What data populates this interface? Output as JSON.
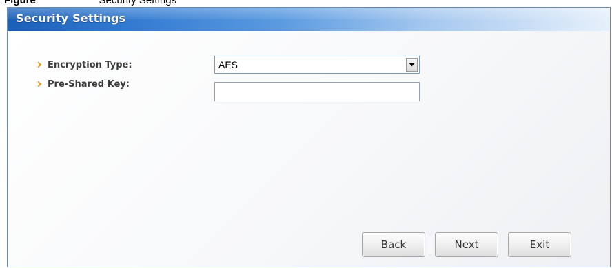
{
  "caption": {
    "prefix": "Figure",
    "text": "Security Settings"
  },
  "panel": {
    "title": "Security Settings"
  },
  "fields": {
    "encryption": {
      "label": "Encryption Type:",
      "selected": "AES"
    },
    "psk": {
      "label": "Pre-Shared Key:",
      "value": ""
    }
  },
  "buttons": {
    "back": "Back",
    "next": "Next",
    "exit": "Exit"
  },
  "icons": {
    "bullet": "chevron-right-icon",
    "dropdown": "triangle-down-icon"
  },
  "colors": {
    "bullet": "#e6a817",
    "header_start": "#1a5fb8",
    "header_end": "#e6f0fb",
    "label": "#3d3d3d"
  }
}
